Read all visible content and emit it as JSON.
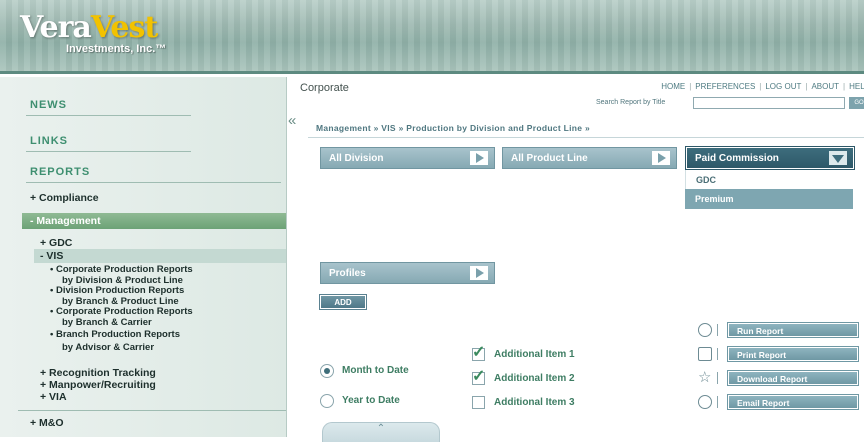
{
  "brand": {
    "name_part1": "Vera",
    "name_part2": "Vest",
    "subtitle": "Investments, Inc.",
    "trademark": "™"
  },
  "sidebar": {
    "news": "NEWS",
    "links": "LINKS",
    "reports": "REPORTS",
    "compliance": "+ Compliance",
    "management": "- Management",
    "gdc": "+ GDC",
    "vis": "- VIS",
    "report_links": [
      {
        "line1": "• Corporate Production Reports",
        "line2": "by Division & Product Line"
      },
      {
        "line1": "• Division Production Reports",
        "line2": "by Branch & Product Line"
      },
      {
        "line1": "• Corporate Production Reports",
        "line2": "by Branch & Carrier"
      },
      {
        "line1": "• Branch Production Reports",
        "line2": "by Advisor & Carrier"
      }
    ],
    "recognition": "+ Recognition Tracking",
    "manpower": "+ Manpower/Recruiting",
    "via": "+ VIA",
    "mo": "+ M&O",
    "collapse_glyph": "«"
  },
  "main": {
    "title": "Corporate",
    "topnav": {
      "home": "HOME",
      "preferences": "PREFERENCES",
      "logout": "LOG OUT",
      "about": "ABOUT",
      "help": "HELP"
    },
    "search_label": "Search Report by Title",
    "search_value": "",
    "go": "GO",
    "breadcrumb": "Management » VIS » Production by Division and Product Line »",
    "dropdowns": {
      "division": "All Division",
      "product_line": "All Product Line",
      "commission": "Paid Commission",
      "profiles": "Profiles"
    },
    "commission_options": [
      "GDC",
      "Premium"
    ],
    "add": "ADD",
    "period": {
      "month": "Month to Date",
      "year": "Year to Date",
      "selected": "Month to Date"
    },
    "items": [
      {
        "label": "Additional Item 1",
        "checked": true
      },
      {
        "label": "Additional Item 2",
        "checked": true
      },
      {
        "label": "Additional Item 3",
        "checked": false
      }
    ],
    "actions": {
      "run": "Run Report",
      "print": "Print Report",
      "download": "Download Report",
      "email": "Email Report"
    },
    "tab_glyph": "⌃"
  }
}
